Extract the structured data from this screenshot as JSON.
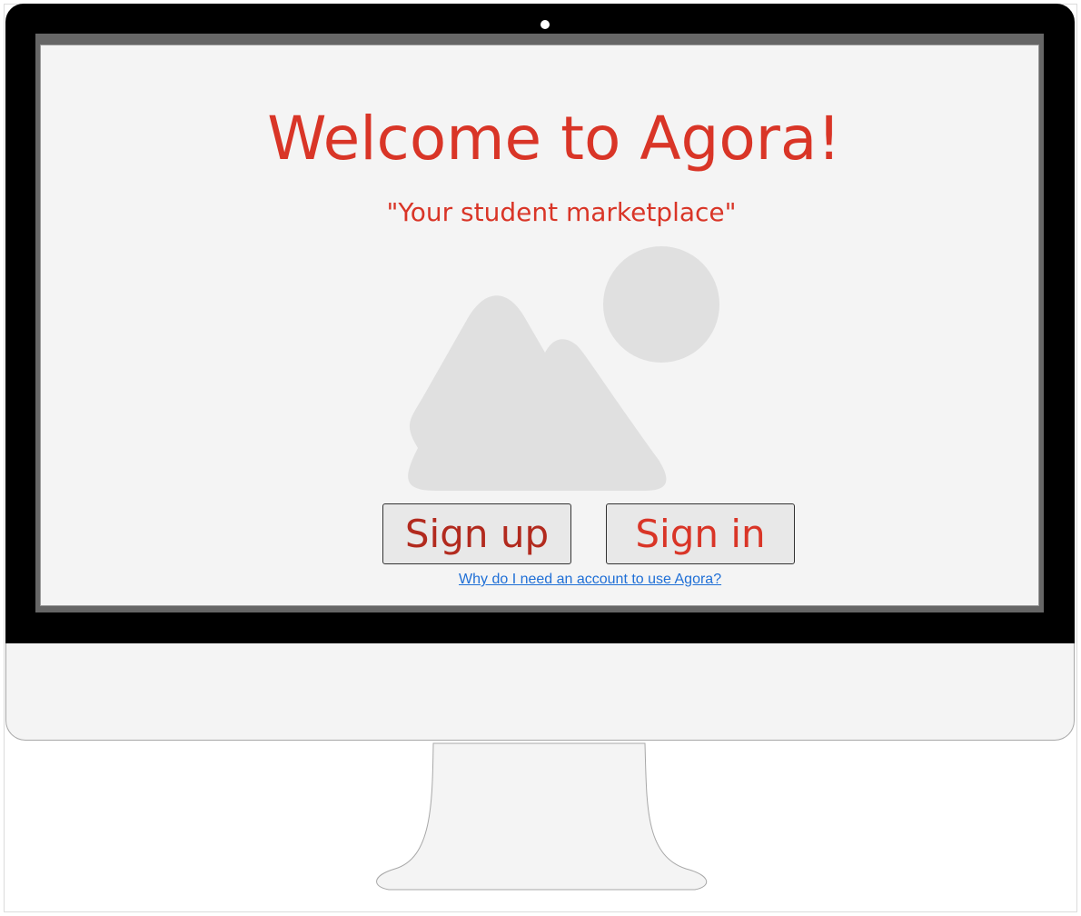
{
  "page": {
    "title": "Welcome to Agora!",
    "subtitle": "\"Your student marketplace\""
  },
  "hero_image": {
    "icon": "image-placeholder-icon",
    "color": "#e0e0e0"
  },
  "actions": {
    "signup_label": "Sign up",
    "signin_label": "Sign in",
    "help_link": "Why do I need an account to use Agora?"
  },
  "colors": {
    "accent": "#d93527",
    "accent_dark": "#b22a1e",
    "link": "#1f6fd6",
    "bezel": "#000000",
    "screen_bg": "#f4f4f4"
  }
}
